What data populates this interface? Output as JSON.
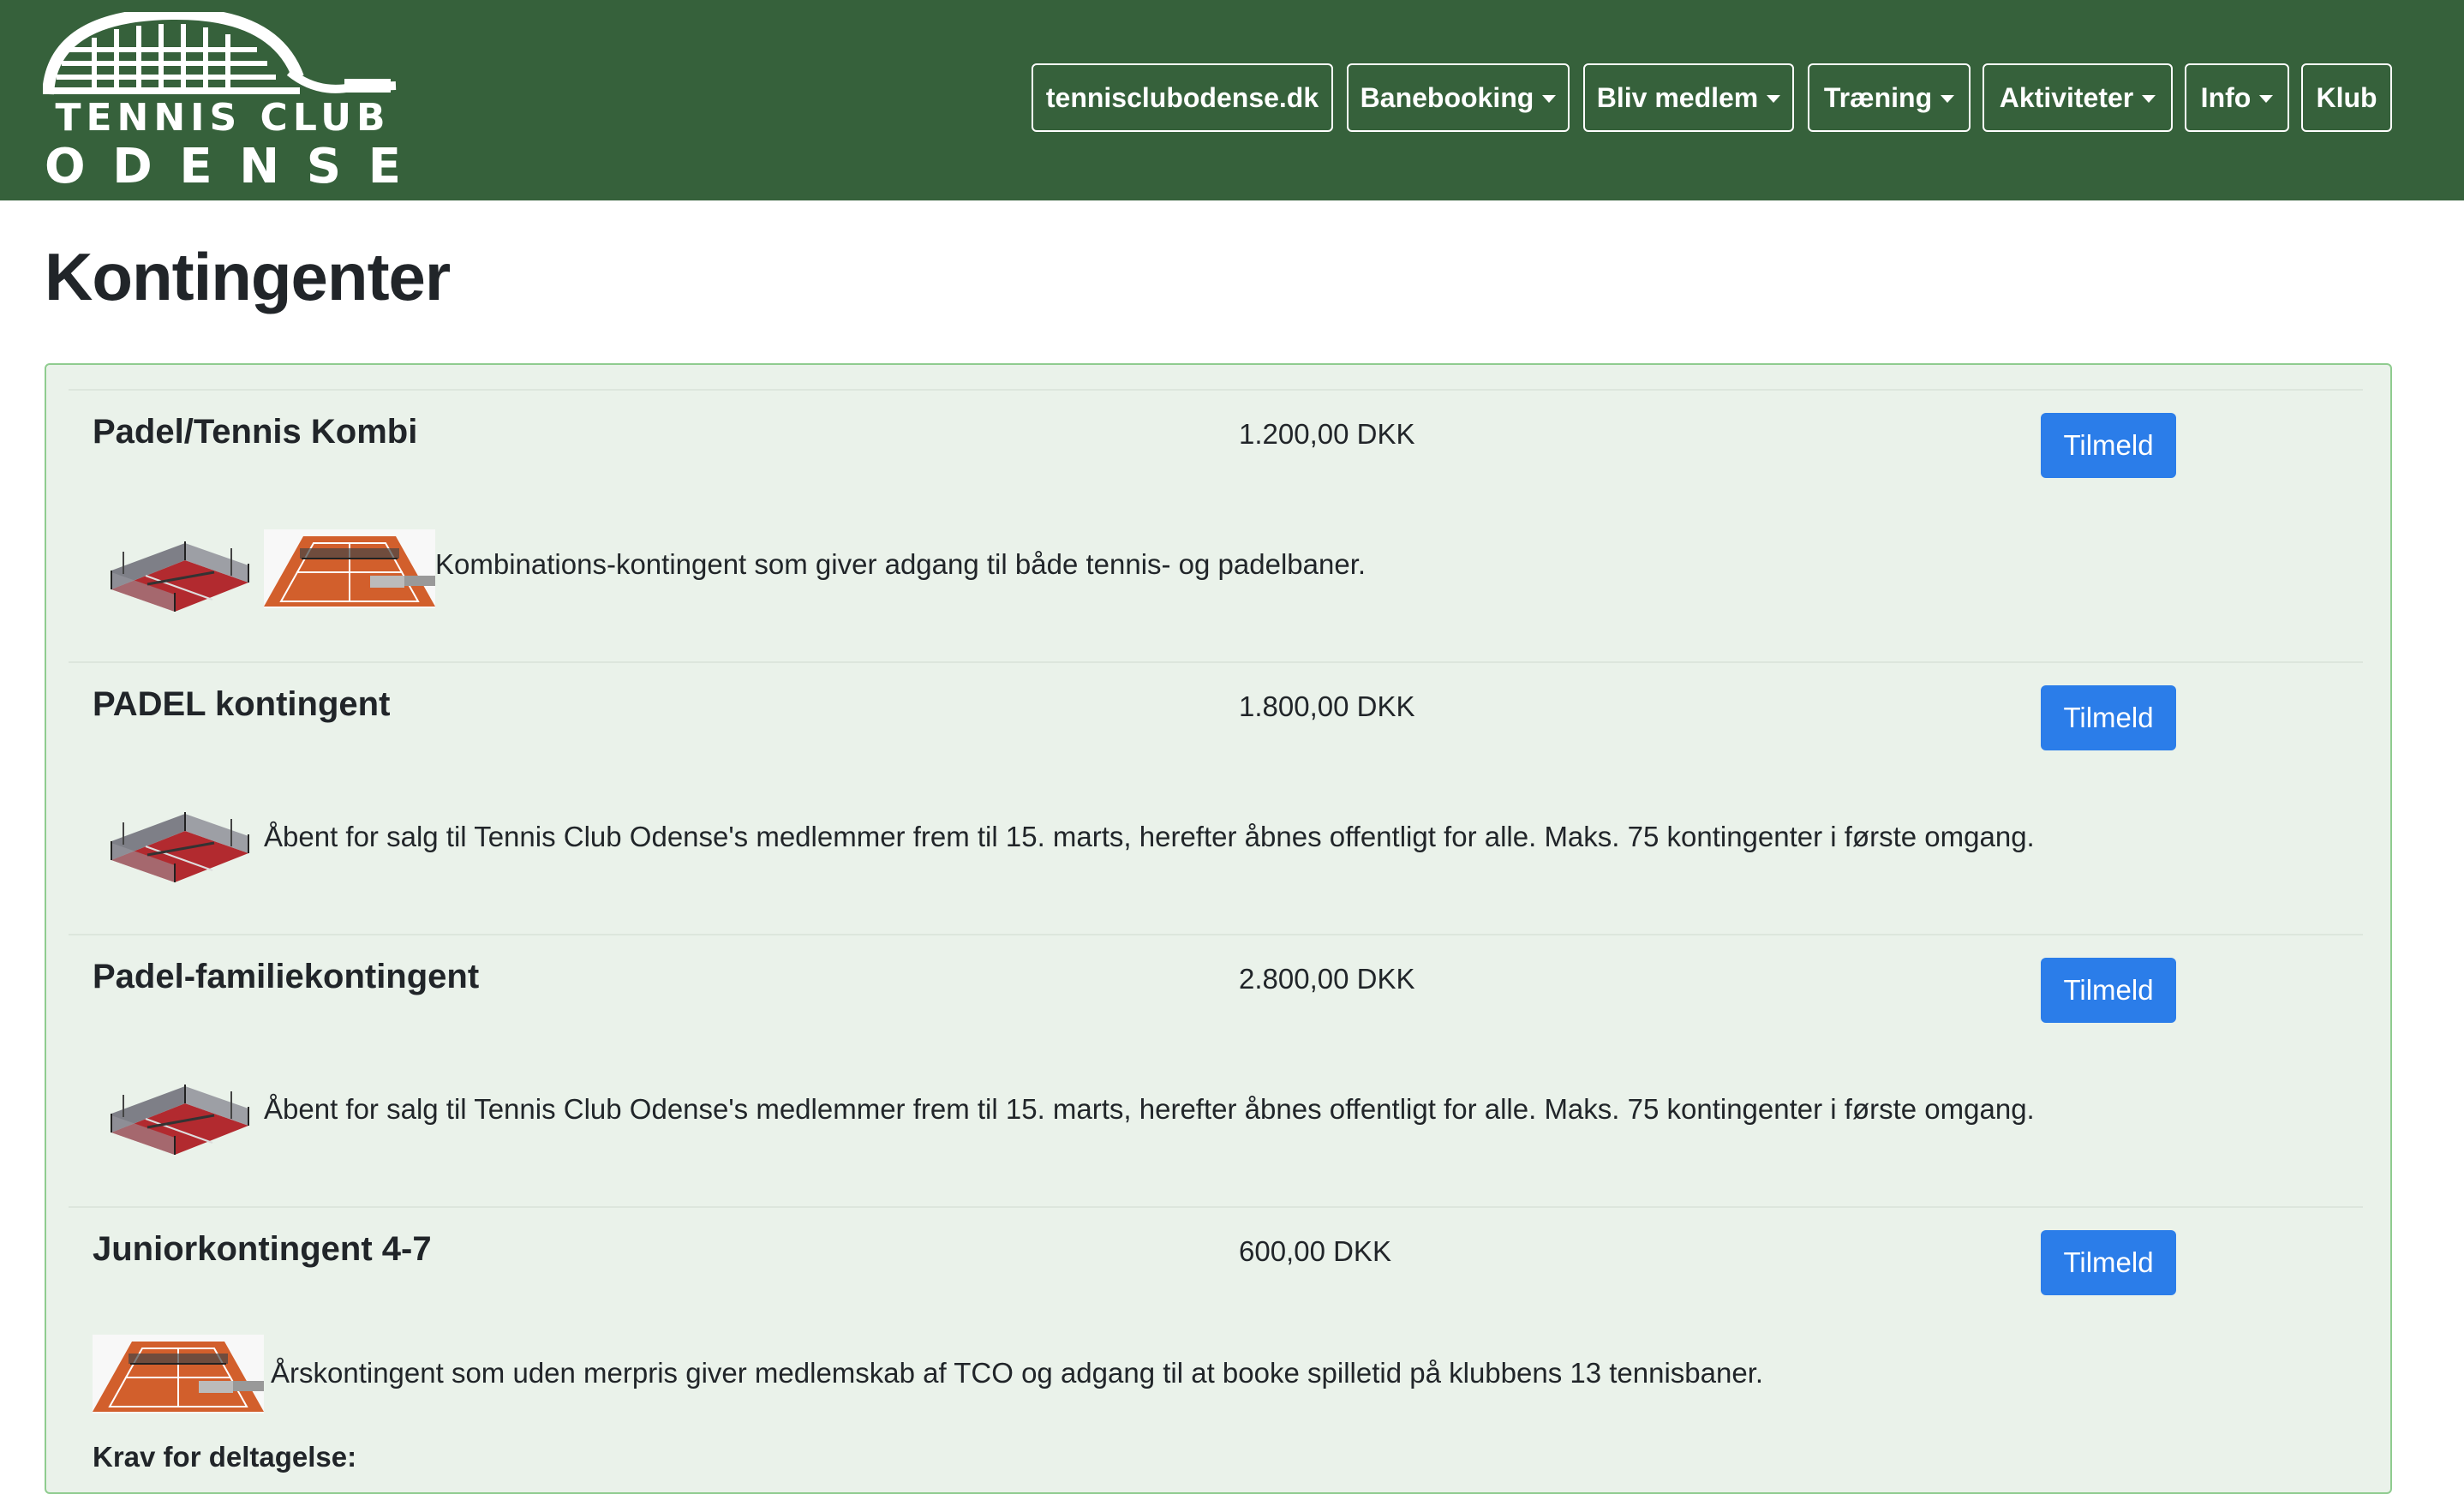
{
  "logo": {
    "line1": "TENNIS CLUB",
    "line2": [
      "O",
      "D",
      "E",
      "N",
      "S",
      "E"
    ]
  },
  "nav": [
    {
      "label": "tennisclubodense.dk",
      "dropdown": false
    },
    {
      "label": "Banebooking",
      "dropdown": true
    },
    {
      "label": "Bliv medlem",
      "dropdown": true
    },
    {
      "label": "Træning",
      "dropdown": true
    },
    {
      "label": "Aktiviteter",
      "dropdown": true
    },
    {
      "label": "Info",
      "dropdown": true
    },
    {
      "label": "Klub",
      "dropdown": false
    }
  ],
  "page_title": "Kontingenter",
  "items": [
    {
      "title": "Padel/Tennis Kombi",
      "price": "1.200,00 DKK",
      "button": "Tilmeld",
      "description": "Kombinations-kontingent som giver adgang til både tennis- og padelbaner.",
      "images": [
        "padel-court-icon",
        "tennis-court-icon"
      ]
    },
    {
      "title": "PADEL kontingent",
      "price": "1.800,00 DKK",
      "button": "Tilmeld",
      "description": "Åbent for salg til Tennis Club Odense's medlemmer frem til 15. marts, herefter åbnes offentligt for alle. Maks. 75 kontingenter i første omgang.",
      "images": [
        "padel-court-icon"
      ]
    },
    {
      "title": "Padel-familiekontingent",
      "price": "2.800,00 DKK",
      "button": "Tilmeld",
      "description": "Åbent for salg til Tennis Club Odense's medlemmer frem til 15. marts, herefter åbnes offentligt for alle. Maks. 75 kontingenter i første omgang.",
      "images": [
        "padel-court-icon"
      ]
    },
    {
      "title": "Juniorkontingent 4-7",
      "price": "600,00 DKK",
      "button": "Tilmeld",
      "description": "Årskontingent som uden merpris giver medlemskab af TCO og adgang til at booke spilletid på klubbens 13 tennisbaner.",
      "images": [
        "tennis-court-icon"
      ]
    }
  ],
  "requirements_title": "Krav for deltagelse:",
  "colors": {
    "header": "#36613b",
    "panel": "#eaf2ea",
    "panel_border": "#8fcc8f",
    "button": "#2b7de9"
  }
}
